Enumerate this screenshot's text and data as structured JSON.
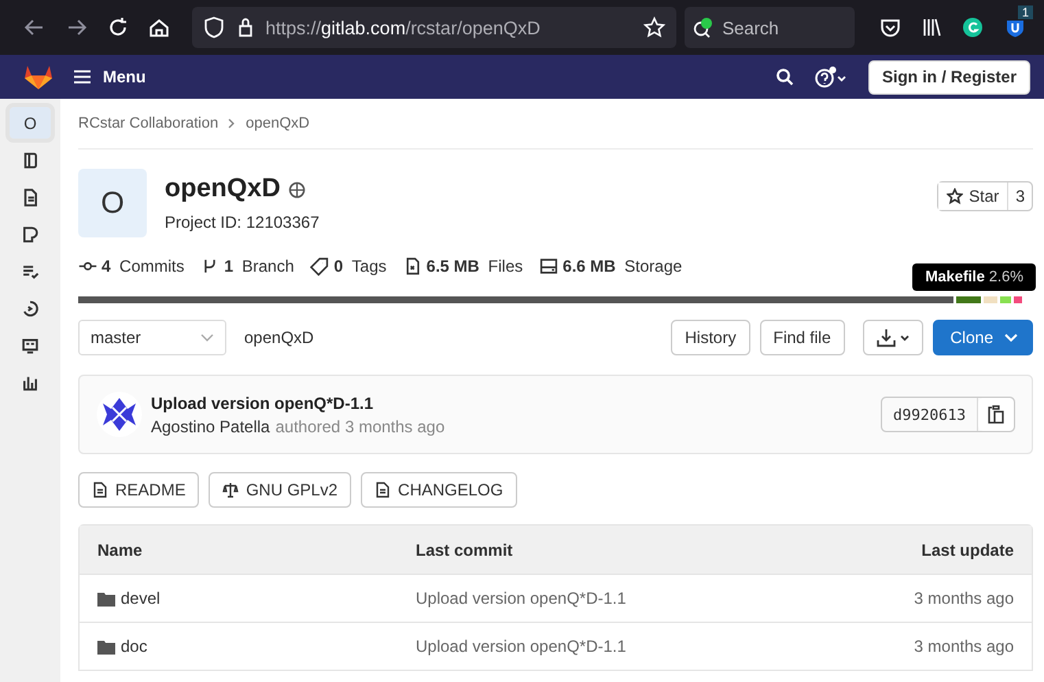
{
  "browser": {
    "url": "https://**gitlab.com**/rcstar/openQxD",
    "search_placeholder": "Search",
    "extension_badge": "1"
  },
  "navbar": {
    "menu_label": "Menu",
    "sign_in": "Sign in / Register"
  },
  "sidebar": {
    "items": [
      {
        "kind": "project",
        "label": "O",
        "selected": true
      },
      {
        "kind": "icon",
        "selected": false
      },
      {
        "kind": "icon",
        "selected": false
      },
      {
        "kind": "icon",
        "selected": false
      },
      {
        "kind": "icon",
        "selected": false
      },
      {
        "kind": "icon",
        "selected": false
      },
      {
        "kind": "icon",
        "selected": false
      },
      {
        "kind": "icon",
        "selected": false
      }
    ]
  },
  "breadcrumb": [
    "RCstar Collaboration",
    "openQxD"
  ],
  "project": {
    "avatar_letter": "O",
    "name": "openQxD",
    "project_id": "Project ID: 12103367",
    "star_label": "Star",
    "star_count": "3"
  },
  "stats": [
    {
      "count": "4",
      "label": "Commits"
    },
    {
      "count": "1",
      "label": "Branch"
    },
    {
      "count": "0",
      "label": "Tags"
    },
    {
      "count": "6.5 MB",
      "label": "Files"
    },
    {
      "count": "6.6 MB",
      "label": "Storage"
    }
  ],
  "language_bar": [
    {
      "color": "#555555"
    },
    {
      "color": "#427819"
    },
    {
      "color": "#f1e0c1"
    },
    {
      "color": "#89e051"
    },
    {
      "color": "#f34b7d"
    }
  ],
  "tooltip": {
    "name": "Makefile",
    "percent": "2.6%"
  },
  "branch": {
    "name": "master",
    "path": "openQxD",
    "history": "History",
    "find_file": "Find file",
    "clone": "Clone"
  },
  "last_commit": {
    "title": "Upload version openQ*D-1.1",
    "author": "Agostino Patella",
    "meta": "authored 3 months ago",
    "sha": "d9920613"
  },
  "doc_buttons": [
    "README",
    "GNU GPLv2",
    "CHANGELOG"
  ],
  "table": {
    "columns": [
      "Name",
      "Last commit",
      "Last update"
    ],
    "rows": [
      {
        "name": "devel",
        "commit": "Upload version openQ*D-1.1",
        "updated": "3 months ago"
      },
      {
        "name": "doc",
        "commit": "Upload version openQ*D-1.1",
        "updated": "3 months ago"
      }
    ]
  }
}
